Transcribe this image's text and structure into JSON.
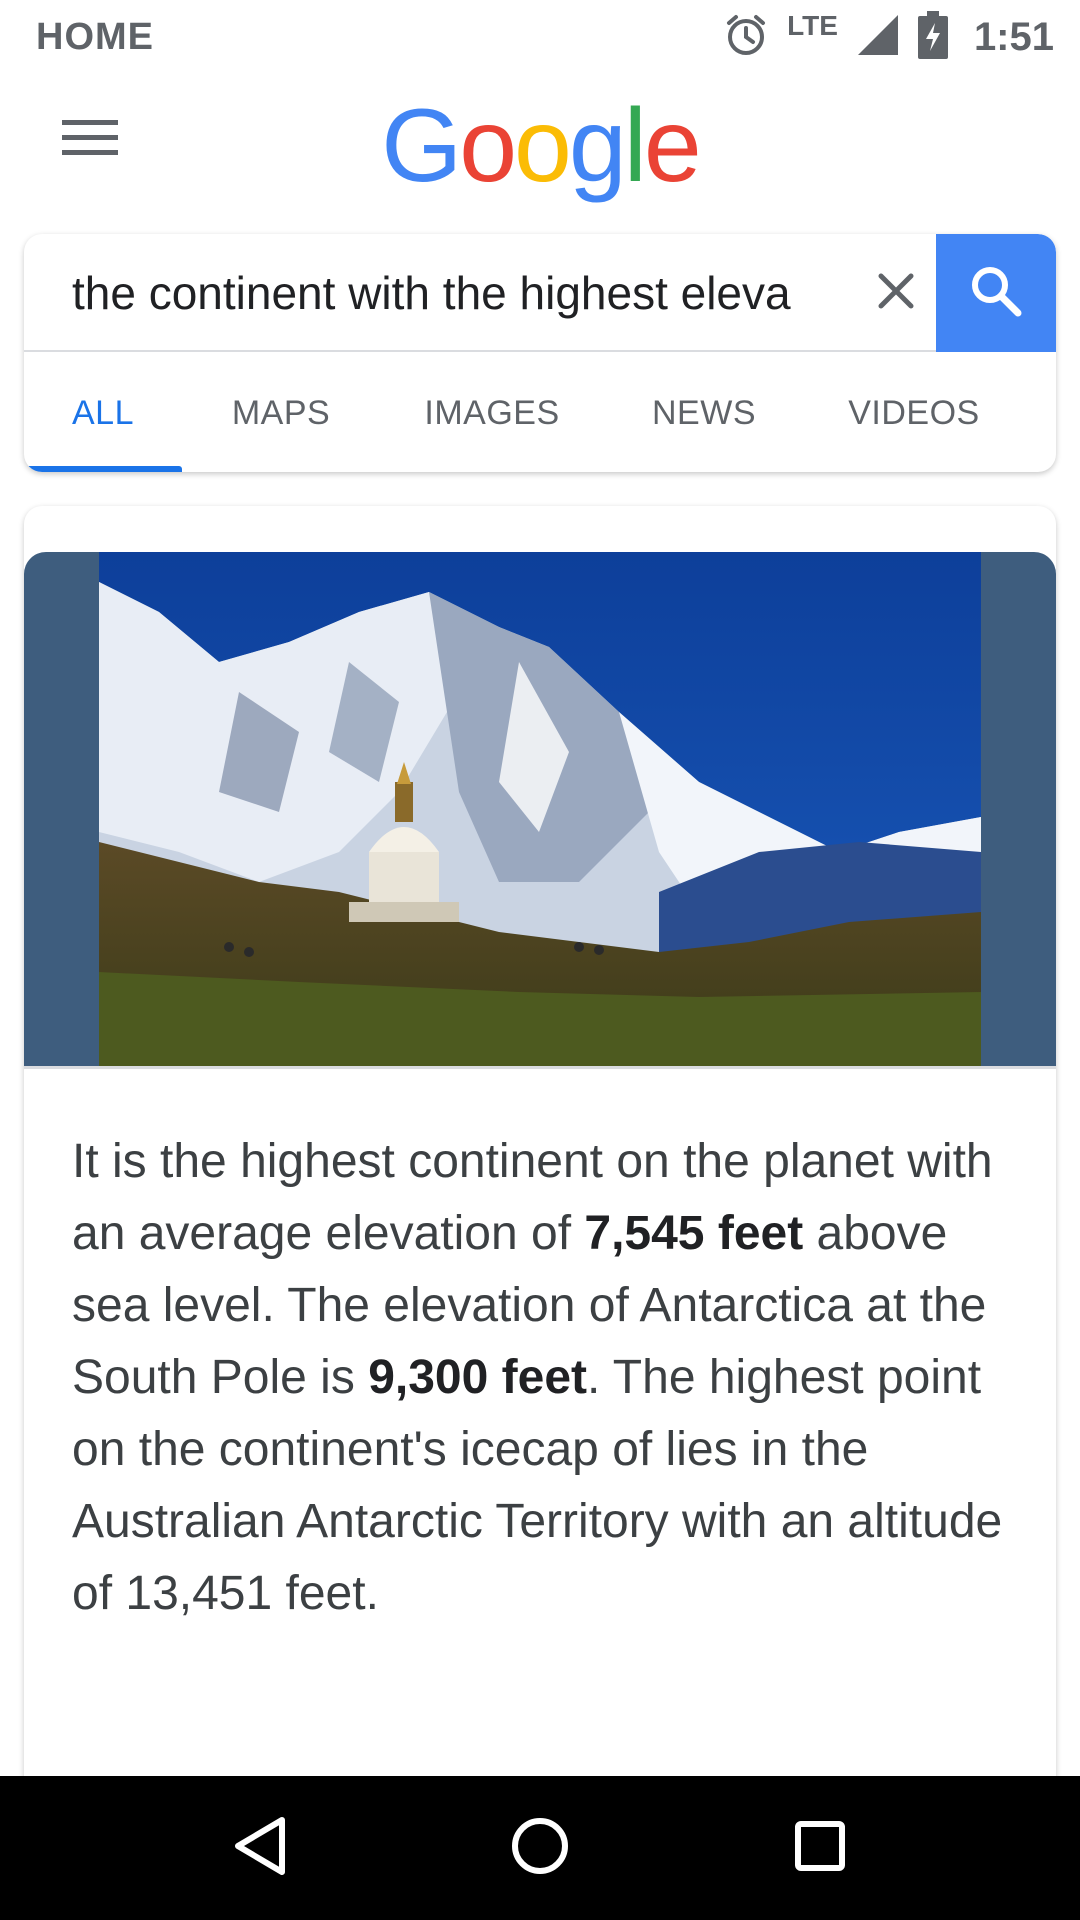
{
  "status_bar": {
    "left_label": "HOME",
    "network": "LTE",
    "time": "1:51",
    "icons": [
      "alarm-icon",
      "signal-icon",
      "battery-charging-icon"
    ]
  },
  "app_bar": {
    "menu_icon": "hamburger-menu-icon",
    "logo_letters": [
      "G",
      "o",
      "o",
      "g",
      "l",
      "e"
    ],
    "logo_colors": [
      "#4285F4",
      "#EA4335",
      "#FBBC05",
      "#4285F4",
      "#34A853",
      "#EA4335"
    ]
  },
  "search": {
    "query": "the continent with the highest eleva",
    "clear_icon": "close-icon",
    "search_icon": "search-icon",
    "accent": "#4285F4"
  },
  "tabs": [
    {
      "label": "ALL",
      "active": true
    },
    {
      "label": "MAPS",
      "active": false
    },
    {
      "label": "IMAGES",
      "active": false
    },
    {
      "label": "NEWS",
      "active": false
    },
    {
      "label": "VIDEOS",
      "active": false
    }
  ],
  "result": {
    "image_subject": "snow-covered mountain with stupa",
    "snippet_parts": [
      {
        "text": "It is the highest continent on the planet with an average elevation of ",
        "bold": false
      },
      {
        "text": "7,545 feet",
        "bold": true
      },
      {
        "text": " above sea level. The elevation of Antarctica at the South Pole is ",
        "bold": false
      },
      {
        "text": "9,300 feet",
        "bold": true
      },
      {
        "text": ". The highest point on the continent's icecap of lies in the Australian Antarctic Territory with an altitude of 13,451 feet.",
        "bold": false
      }
    ]
  },
  "nav_bar": {
    "buttons": [
      "back-icon",
      "home-icon",
      "recents-icon"
    ]
  },
  "colors": {
    "active_tab": "#1a73e8",
    "tab_text": "#5f6368",
    "image_frame": "#3e5d7e"
  }
}
